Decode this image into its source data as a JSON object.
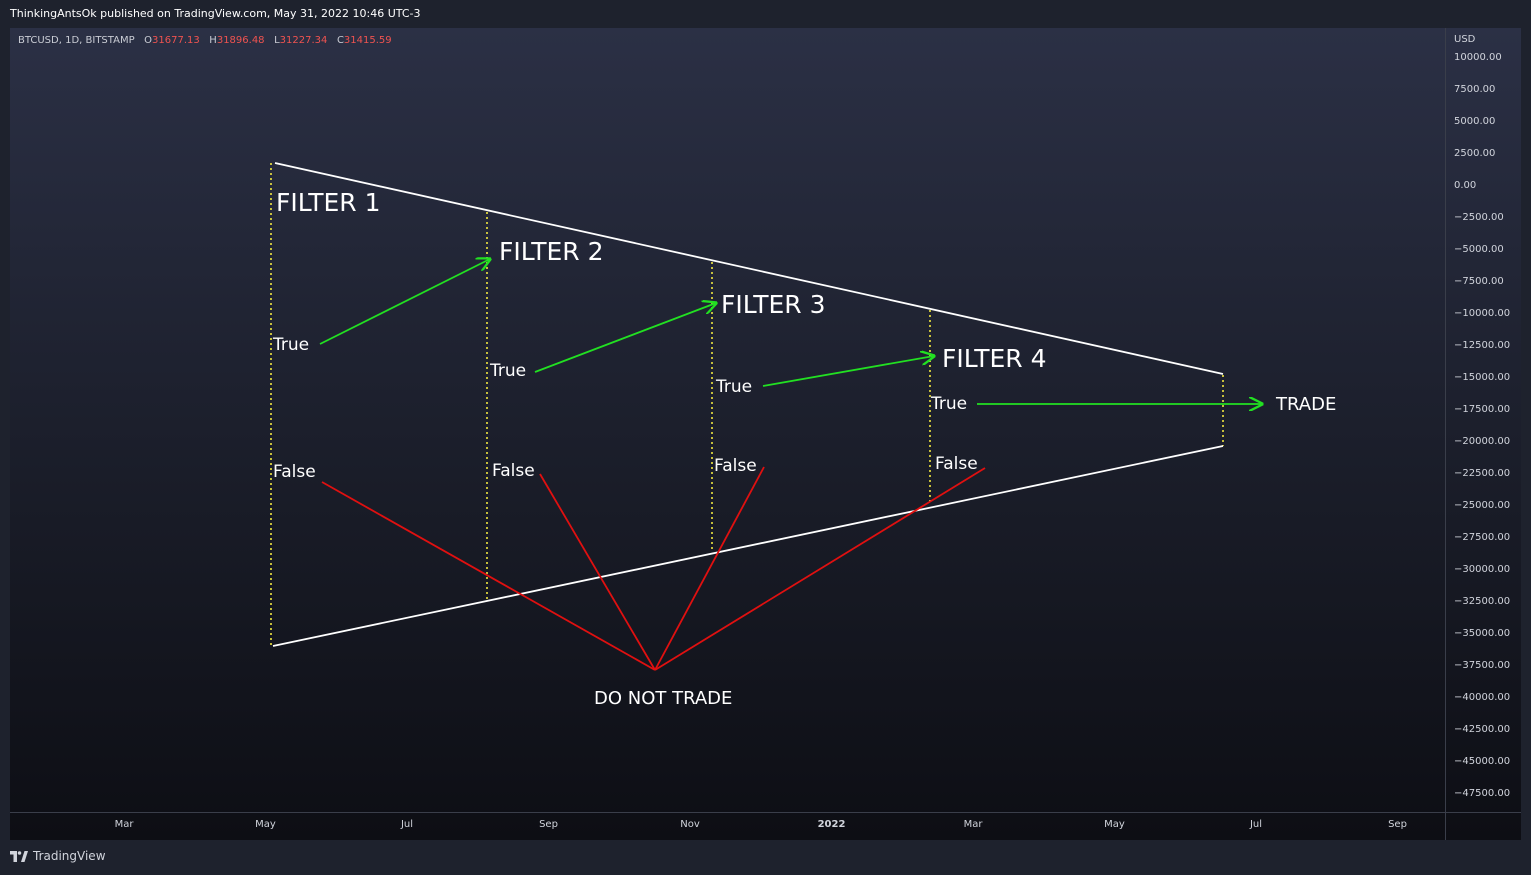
{
  "header": {
    "publisher_line": "ThinkingAntsOk published on TradingView.com, May 31, 2022 10:46 UTC-3"
  },
  "symbol": {
    "name": "BTCUSD, 1D, BITSTAMP",
    "open_label": "O",
    "open": "31677.13",
    "high_label": "H",
    "high": "31896.48",
    "low_label": "L",
    "low": "31227.34",
    "close_label": "C",
    "close": "31415.59"
  },
  "price_axis": {
    "currency": "USD",
    "labels": [
      "10000.00",
      "7500.00",
      "5000.00",
      "2500.00",
      "0.00",
      "−2500.00",
      "−5000.00",
      "−7500.00",
      "−10000.00",
      "−12500.00",
      "−15000.00",
      "−17500.00",
      "−20000.00",
      "−22500.00",
      "−25000.00",
      "−27500.00",
      "−30000.00",
      "−32500.00",
      "−35000.00",
      "−37500.00",
      "−40000.00",
      "−42500.00",
      "−45000.00",
      "−47500.00"
    ]
  },
  "time_axis": {
    "labels": [
      "Mar",
      "May",
      "Jul",
      "Sep",
      "Nov",
      "2022",
      "Mar",
      "May",
      "Jul",
      "Sep"
    ]
  },
  "diagram": {
    "filters": [
      "FILTER 1",
      "FILTER 2",
      "FILTER 3",
      "FILTER 4"
    ],
    "true_labels": [
      "True",
      "True",
      "True",
      "True"
    ],
    "false_labels": [
      "False",
      "False",
      "False",
      "False"
    ],
    "trade_label": "TRADE",
    "no_trade_label": "DO NOT TRADE"
  },
  "colors": {
    "true_arrow": "#22e022",
    "false_line": "#e01010",
    "outline": "#ffffff",
    "guide": "#f0e640",
    "ohlc_value": "#ef5350"
  },
  "footer": {
    "brand": "TradingView",
    "logo_icon": "tradingview-logo-icon"
  }
}
